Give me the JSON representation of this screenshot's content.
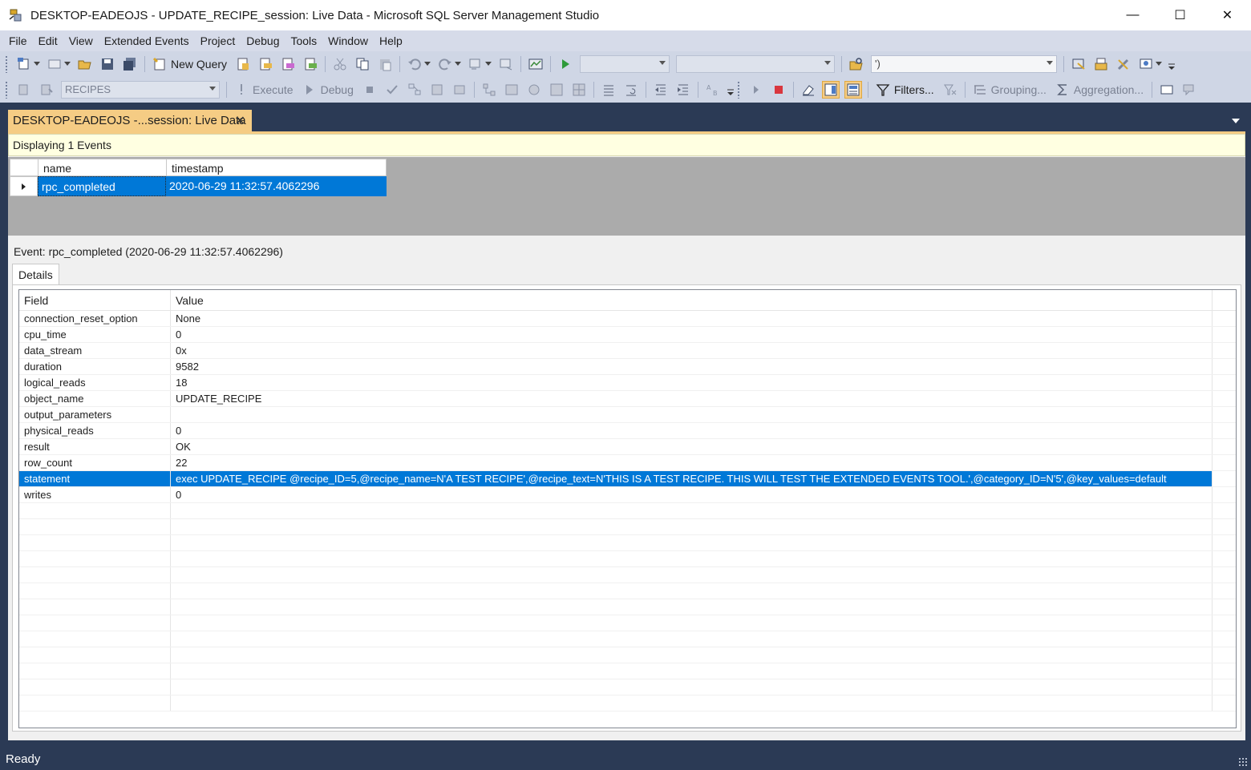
{
  "window": {
    "title": "DESKTOP-EADEOJS - UPDATE_RECIPE_session: Live Data - Microsoft SQL Server Management Studio",
    "minimize": "—",
    "maximize": "☐",
    "close": "✕"
  },
  "menu": [
    "File",
    "Edit",
    "View",
    "Extended Events",
    "Project",
    "Debug",
    "Tools",
    "Window",
    "Help"
  ],
  "toolbar1": {
    "new_query": "New Query",
    "search_combo_value": "')"
  },
  "toolbar2": {
    "database_combo": "RECIPES",
    "execute": "Execute",
    "debug": "Debug",
    "filters": "Filters...",
    "grouping": "Grouping...",
    "aggregation": "Aggregation..."
  },
  "doc_tab": {
    "label": "DESKTOP-EADEOJS -...session: Live Data",
    "close": "✕"
  },
  "events_info": "Displaying 1 Events",
  "events_grid": {
    "columns": [
      "name",
      "timestamp"
    ],
    "rows": [
      {
        "name": "rpc_completed",
        "timestamp": "2020-06-29 11:32:57.4062296"
      }
    ]
  },
  "event_title": "Event: rpc_completed (2020-06-29 11:32:57.4062296)",
  "details_tab": "Details",
  "details_grid": {
    "columns": [
      "Field",
      "Value"
    ],
    "rows": [
      {
        "field": "connection_reset_option",
        "value": "None"
      },
      {
        "field": "cpu_time",
        "value": "0"
      },
      {
        "field": "data_stream",
        "value": "0x"
      },
      {
        "field": "duration",
        "value": "9582"
      },
      {
        "field": "logical_reads",
        "value": "18"
      },
      {
        "field": "object_name",
        "value": "UPDATE_RECIPE"
      },
      {
        "field": "output_parameters",
        "value": ""
      },
      {
        "field": "physical_reads",
        "value": "0"
      },
      {
        "field": "result",
        "value": "OK"
      },
      {
        "field": "row_count",
        "value": "22"
      },
      {
        "field": "statement",
        "value": "exec UPDATE_RECIPE @recipe_ID=5,@recipe_name=N'A TEST RECIPE',@recipe_text=N'THIS IS A TEST RECIPE. THIS WILL TEST THE EXTENDED EVENTS TOOL.',@category_ID=N'5',@key_values=default"
      },
      {
        "field": "writes",
        "value": "0"
      }
    ],
    "selected_field": "statement"
  },
  "status": "Ready",
  "colors": {
    "accent": "#0078d7",
    "tab_gold": "#f5cc84",
    "frame": "#2b3a55",
    "info_bar": "#ffffe1"
  }
}
